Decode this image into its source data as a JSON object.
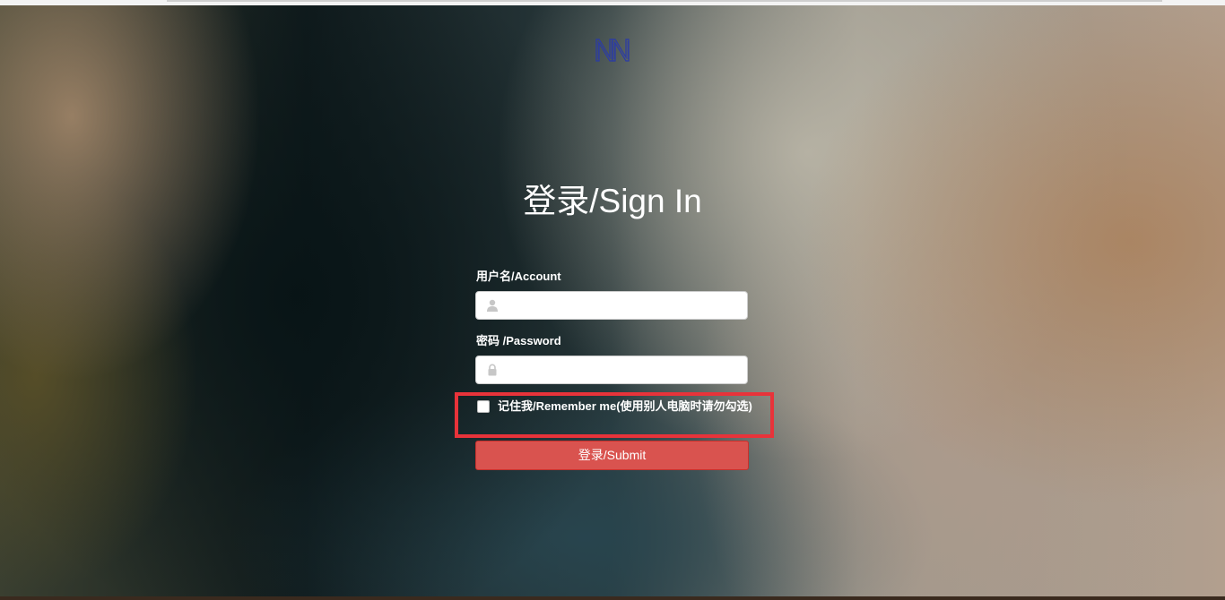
{
  "logo": {
    "icon": "nn-logo-icon",
    "color": "#2a3aa8"
  },
  "title": "登录/Sign In",
  "account": {
    "label": "用户名/Account",
    "value": "",
    "icon": "user-icon"
  },
  "password": {
    "label": "密码   /Password",
    "value": "",
    "icon": "lock-icon"
  },
  "remember": {
    "label": "记住我/Remember me(使用别人电脑时请勿勾选)",
    "checked": false,
    "highlight_color": "#e8333a"
  },
  "submit": {
    "label": "登录/Submit",
    "color": "#d9534f"
  }
}
